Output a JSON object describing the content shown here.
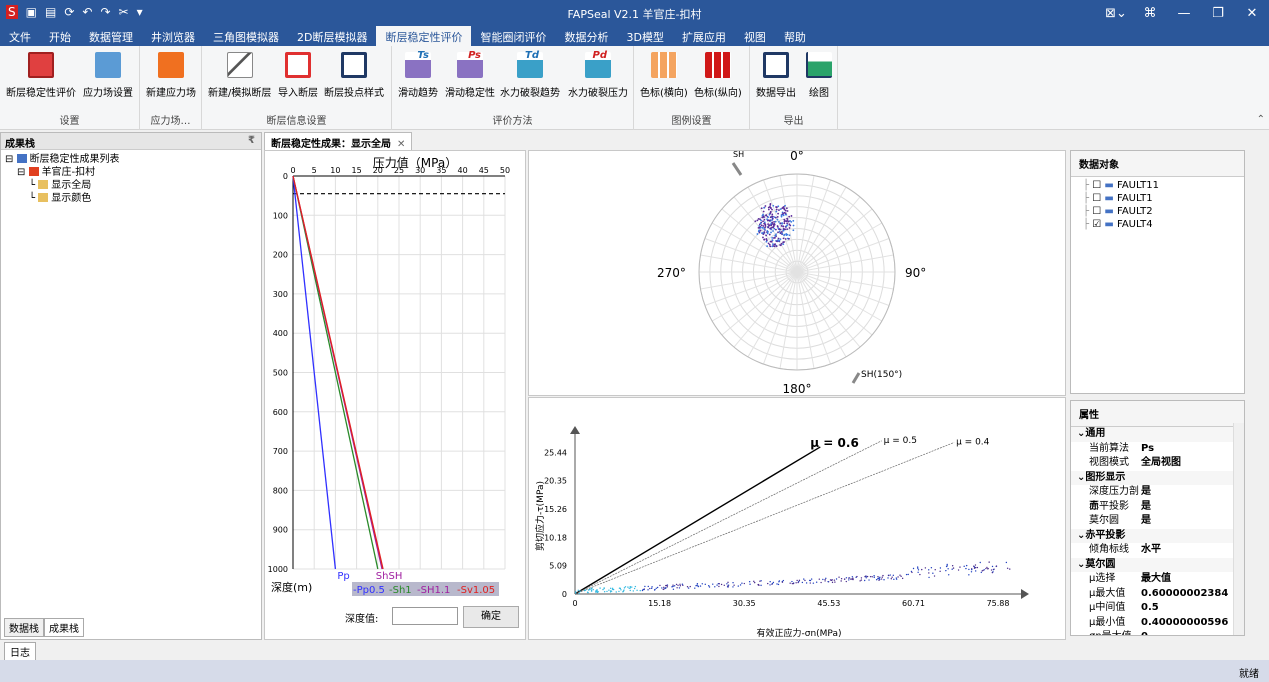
{
  "app": {
    "title": "FAPSeal V2.1  羊官庄-扣村",
    "window_controls": [
      "⊠⌄",
      "⌘",
      "—",
      "❐",
      "✕"
    ]
  },
  "quick_access": [
    "S",
    "▣",
    "▤",
    "⟳",
    "↶",
    "↷",
    "✂",
    "▾"
  ],
  "menu": [
    "文件",
    "开始",
    "数据管理",
    "井浏览器",
    "三角图模拟器",
    "2D断层模拟器",
    "断层稳定性评价",
    "智能圈闭评价",
    "数据分析",
    "3D模型",
    "扩展应用",
    "视图",
    "帮助"
  ],
  "menu_active_index": 6,
  "ribbon": {
    "groups": [
      {
        "label": "设置",
        "buttons": [
          "断层稳定性评价",
          "应力场设置"
        ]
      },
      {
        "label": "应力场…",
        "buttons": [
          "新建应力场"
        ]
      },
      {
        "label": "断层信息设置",
        "buttons": [
          "新建/模拟断层",
          "导入断层",
          "断层投点样式"
        ]
      },
      {
        "label": "评价方法",
        "buttons": [
          "滑动趋势",
          "滑动稳定性",
          "水力破裂趋势",
          "水力破裂压力"
        ]
      },
      {
        "label": "图例设置",
        "buttons": [
          "色标(横向)",
          "色标(纵向)"
        ]
      },
      {
        "label": "导出",
        "buttons": [
          "数据导出",
          "绘图"
        ]
      }
    ],
    "icon_glyphs": [
      "Ts",
      "Ps",
      "Td",
      "Pd"
    ]
  },
  "left_panel": {
    "title": "成果栈",
    "pin": "₹",
    "tree": [
      {
        "level": 0,
        "label": "断层稳定性成果列表"
      },
      {
        "level": 1,
        "label": "羊官庄-扣村"
      },
      {
        "level": 2,
        "label": "显示全局"
      },
      {
        "level": 2,
        "label": "显示颜色"
      }
    ],
    "tabs": [
      "数据栈",
      "成果栈"
    ]
  },
  "doc_tab": {
    "label": "断层稳定性成果：显示全局",
    "close": "✕"
  },
  "pressure_chart": {
    "x_title": "压力值（MPa）",
    "x_ticks": [
      "0",
      "5",
      "10",
      "15",
      "20",
      "25",
      "30",
      "35",
      "40",
      "45",
      "50"
    ],
    "y_ticks": [
      "0",
      "100",
      "200",
      "300",
      "400",
      "500",
      "600",
      "700",
      "800",
      "900",
      "1000"
    ],
    "y_label": "深度(m)",
    "end_labels": {
      "pp": "Pp",
      "sh": "ShSH"
    },
    "legend": [
      "-Pp0.5",
      "-Sh1",
      "-SH1.1",
      "-Sv1.05"
    ],
    "legend_colors": [
      "#3030ff",
      "#2a8a2a",
      "#a020a0",
      "#e02020"
    ],
    "depth_label": "深度值:",
    "depth_value": "",
    "confirm": "确定"
  },
  "chart_data": [
    {
      "type": "line",
      "x": [
        0,
        1000
      ],
      "xlabel": "压力值（MPa）",
      "ylabel": "深度(m)",
      "xlim": [
        0,
        50
      ],
      "ylim": [
        0,
        1000
      ],
      "series": [
        {
          "name": "-Pp0.5",
          "points": [
            [
              0,
              0
            ],
            [
              10,
              1000
            ]
          ]
        },
        {
          "name": "-Sh1",
          "points": [
            [
              0,
              0
            ],
            [
              20,
              1000
            ]
          ]
        },
        {
          "name": "-SH1.1",
          "points": [
            [
              0,
              0
            ],
            [
              21,
              1000
            ]
          ]
        },
        {
          "name": "-Sv1.05",
          "points": [
            [
              0,
              0
            ],
            [
              21,
              1000
            ]
          ]
        }
      ],
      "reference_line_depth": 45
    },
    {
      "type": "scatter",
      "xlabel": "有效正应力-σn(MPa)",
      "ylabel": "剪切应力-τ(MPa)",
      "x_ticks": [
        "0",
        "15.18",
        "30.35",
        "45.53",
        "60.71",
        "75.88"
      ],
      "y_ticks": [
        "0",
        "5.09",
        "10.18",
        "15.26",
        "20.35",
        "25.44"
      ],
      "xlim": [
        0,
        80
      ],
      "ylim": [
        0,
        28
      ],
      "friction_lines": [
        {
          "label": "μ = 0.6",
          "slope": 0.6
        },
        {
          "label": "μ = 0.5",
          "slope": 0.5
        },
        {
          "label": "μ = 0.4",
          "slope": 0.4
        }
      ]
    }
  ],
  "stereonet": {
    "labels": {
      "north": "0°",
      "east": "90°",
      "south": "180°",
      "west": "270°"
    },
    "sh_label": "SH",
    "sh150_label": "SH(150°)"
  },
  "data_objects": {
    "title": "数据对象",
    "items": [
      {
        "label": "FAULT11",
        "checked": false
      },
      {
        "label": "FAULT1",
        "checked": false
      },
      {
        "label": "FAULT2",
        "checked": false
      },
      {
        "label": "FAULT4",
        "checked": true
      }
    ]
  },
  "properties": {
    "title": "属性",
    "rows": [
      {
        "type": "sec",
        "k": "通用"
      },
      {
        "k": "当前算法",
        "v": "Ps"
      },
      {
        "k": "视图模式",
        "v": "全局视图"
      },
      {
        "type": "sec",
        "k": "图形显示"
      },
      {
        "k": "深度压力剖面",
        "v": "是"
      },
      {
        "k": "赤平投影",
        "v": "是"
      },
      {
        "k": "莫尔圆",
        "v": "是"
      },
      {
        "type": "sec",
        "k": "赤平投影"
      },
      {
        "k": "倾角标线",
        "v": "水平"
      },
      {
        "type": "sec",
        "k": "莫尔圆"
      },
      {
        "k": "μ选择",
        "v": "最大值"
      },
      {
        "k": "μ最大值",
        "v": "0.60000002384"
      },
      {
        "k": "μ中间值",
        "v": "0.5"
      },
      {
        "k": "μ最小值",
        "v": "0.40000000596"
      },
      {
        "k": "σn最大值",
        "v": "0"
      }
    ]
  },
  "log_tab": "日志",
  "status": "就绪"
}
